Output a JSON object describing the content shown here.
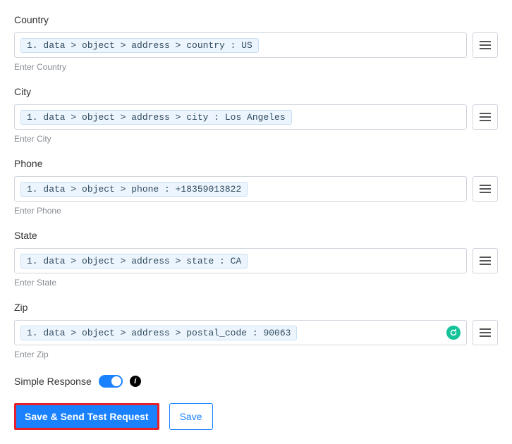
{
  "fields": [
    {
      "label": "Country",
      "token": "1. data > object > address > country : US",
      "helper": "Enter Country",
      "hasBadge": false
    },
    {
      "label": "City",
      "token": "1. data > object > address > city : Los Angeles",
      "helper": "Enter City",
      "hasBadge": false
    },
    {
      "label": "Phone",
      "token": "1. data > object > phone : +18359013822",
      "helper": "Enter Phone",
      "hasBadge": false
    },
    {
      "label": "State",
      "token": "1. data > object > address > state : CA",
      "helper": "Enter State",
      "hasBadge": false
    },
    {
      "label": "Zip",
      "token": "1. data > object > address > postal_code : 90063",
      "helper": "Enter Zip",
      "hasBadge": true
    }
  ],
  "simpleResponse": {
    "label": "Simple Response",
    "enabled": true
  },
  "actions": {
    "primary": "Save & Send Test Request",
    "secondary": "Save"
  },
  "icons": {
    "info": "i"
  }
}
